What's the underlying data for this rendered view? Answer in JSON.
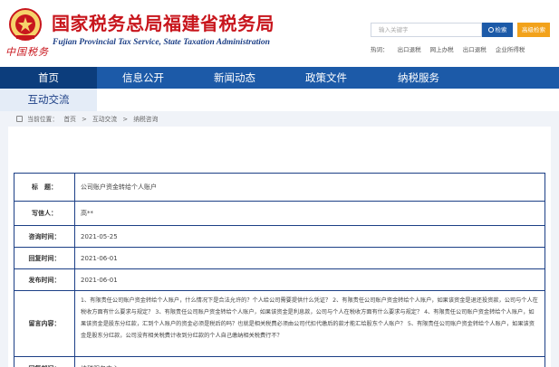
{
  "header": {
    "logo_script": "中国税务",
    "title": "国家税务总局福建省税务局",
    "subtitle": "Fujian Provincial Tax Service, State Taxation Administration",
    "search_placeholder": "输入关键字",
    "search_button": "检索",
    "advanced_button": "高级检索",
    "quicklinks": [
      "热词：",
      "出口退税",
      "网上办税",
      "出口退税",
      "企业所得税"
    ]
  },
  "nav": {
    "items": [
      {
        "label": "首页",
        "active": true
      },
      {
        "label": "信息公开",
        "active": false
      },
      {
        "label": "新闻动态",
        "active": false
      },
      {
        "label": "政策文件",
        "active": false
      },
      {
        "label": "纳税服务",
        "active": false
      }
    ],
    "sub_items": [
      {
        "label": "互动交流"
      }
    ]
  },
  "breadcrumb": {
    "prefix": "当前位置：",
    "items": [
      "首页",
      ">",
      "互动交流",
      ">",
      "纳税咨询"
    ]
  },
  "detail": {
    "rows": [
      {
        "label": "标　题：",
        "value": "公司账户资金转给个人账户"
      },
      {
        "label": "写信人：",
        "value": "高**"
      },
      {
        "label": "咨询时间：",
        "value": "2021-05-25"
      },
      {
        "label": "回复时间：",
        "value": "2021-06-01"
      },
      {
        "label": "发布时间：",
        "value": "2021-06-01"
      },
      {
        "label": "留言内容：",
        "value": "1、有限责任公司账户资金转给个人账户，什么情况下是合法允许的？个人给公司需要提供什么凭证？ 2、有限责任公司账户资金转给个人账户，如果该资金是退还投资款，公司与个人在税收方面有什么要求与规定？ 3、有限责任公司账户资金转给个人账户，如果该资金是利息款，公司与个人在税收方面有什么要求与规定？ 4、有限责任公司账户资金转给个人账户，如果该资金是股东分红款，汇到个人账户的资金必须是税后的吗？也就是相关税费必须由公司代扣代缴后的款才能汇给股东个人账户？ 5、有限责任公司账户资金转给个人账户，如果该资金是股东分红款，公司没有相关税费计收到分红款的个人自己缴纳相关税费行不？"
      },
      {
        "label": "回复部门：",
        "value": "纳税服务中心"
      }
    ]
  },
  "colors": {
    "brand_red": "#c8161d",
    "nav_blue": "#1c5aa8",
    "nav_active": "#0c3d7c",
    "accent_orange": "#f2a21b",
    "table_border": "#1c3f86"
  }
}
